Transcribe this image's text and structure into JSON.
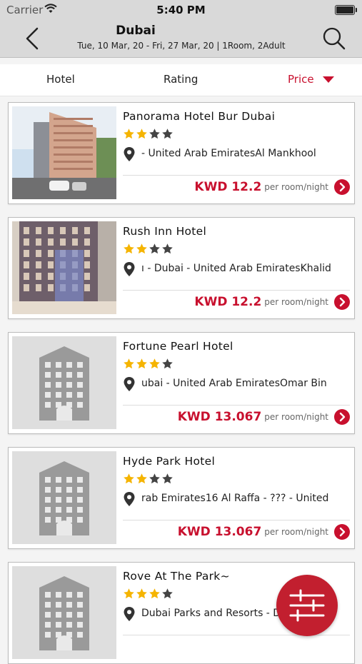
{
  "status": {
    "carrier": "Carrier",
    "time": "5:40 PM"
  },
  "header": {
    "title": "Dubai",
    "subtitle": "Tue, 10 Mar, 20 - Fri, 27 Mar, 20 |  1Room, 2Adult"
  },
  "sort": {
    "hotel": "Hotel",
    "rating": "Rating",
    "price": "Price"
  },
  "per_label": "per room/night",
  "hotels": [
    {
      "name": "Panorama Hotel Bur Dubai",
      "stars": 2,
      "address": "- United Arab EmiratesAl Mankhool",
      "price": "KWD 12.2",
      "image": "building-photo-tan"
    },
    {
      "name": "Rush Inn Hotel",
      "stars": 2,
      "address": "ı - Dubai - United Arab EmiratesKhalid",
      "price": "KWD 12.2",
      "image": "building-photo-night"
    },
    {
      "name": "Fortune Pearl Hotel",
      "stars": 3,
      "address": "ubai - United Arab EmiratesOmar Bin",
      "price": "KWD 13.067",
      "image": "placeholder-building"
    },
    {
      "name": "Hyde Park Hotel",
      "stars": 2,
      "address": "rab Emirates16 Al Raffa - ??? - United",
      "price": "KWD 13.067",
      "image": "placeholder-building"
    },
    {
      "name": "Rove At The Park~",
      "stars": 3,
      "address": "Dubai Parks and Resorts - Dubai 94",
      "price": "",
      "image": "placeholder-building"
    }
  ],
  "colors": {
    "accent": "#c8102e",
    "star": "#f5b400",
    "star_empty": "#444444"
  }
}
